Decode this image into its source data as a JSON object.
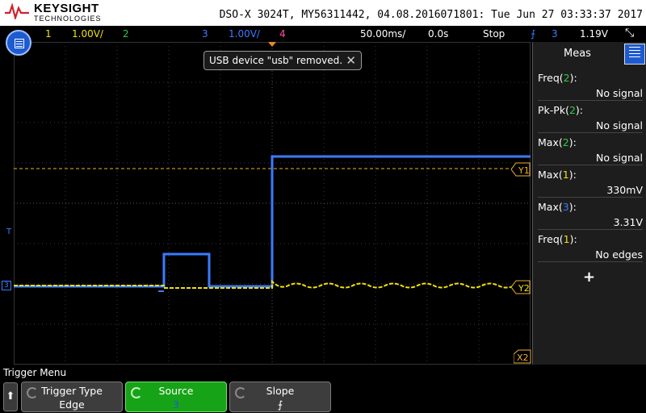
{
  "header": {
    "brand": "KEYSIGHT",
    "brand_sub": "TECHNOLOGIES",
    "info": "DSO-X 3024T, MY56311442, 04.08.2016071801: Tue Jun 27 03:33:37 2017"
  },
  "status": {
    "ch1_num": "1",
    "ch1_scale": "1.00V/",
    "ch2_num": "2",
    "ch3_num": "3",
    "ch3_scale": "1.00V/",
    "ch4_num": "4",
    "timebase": "50.00ms/",
    "delay": "0.0s",
    "run_state": "Stop",
    "trigger_source": "3",
    "trigger_level": "1.19V"
  },
  "toast": {
    "message": "USB device \"usb\" removed."
  },
  "cursors": {
    "y1": "Y1",
    "y2": "Y2",
    "x2": "X2"
  },
  "markers": {
    "trig_level": "T",
    "ch3": "3"
  },
  "meas": {
    "title": "Meas",
    "rows": [
      {
        "name": "Freq",
        "src": "2",
        "value": "No signal",
        "src_color": "#2ecc40"
      },
      {
        "name": "Pk-Pk",
        "src": "2",
        "value": "No signal",
        "src_color": "#2ecc40"
      },
      {
        "name": "Max",
        "src": "2",
        "value": "No signal",
        "src_color": "#2ecc40"
      },
      {
        "name": "Max",
        "src": "1",
        "value": "330mV",
        "src_color": "#f1e00a"
      },
      {
        "name": "Max",
        "src": "3",
        "value": "3.31V",
        "src_color": "#3b7bff"
      },
      {
        "name": "Freq",
        "src": "1",
        "value": "No edges",
        "src_color": "#f1e00a"
      }
    ],
    "add": "+"
  },
  "softkeys": {
    "title": "Trigger Menu",
    "trigger_type_label": "Trigger Type",
    "trigger_type_value": "Edge",
    "source_label": "Source",
    "source_value": "3",
    "slope_label": "Slope",
    "slope_value": "⨍"
  },
  "colors": {
    "ch1": "#f1e00a",
    "ch2": "#2ecc40",
    "ch3": "#3b7bff",
    "ch4": "#ff4fa0",
    "accent": "#1e5bd1"
  }
}
